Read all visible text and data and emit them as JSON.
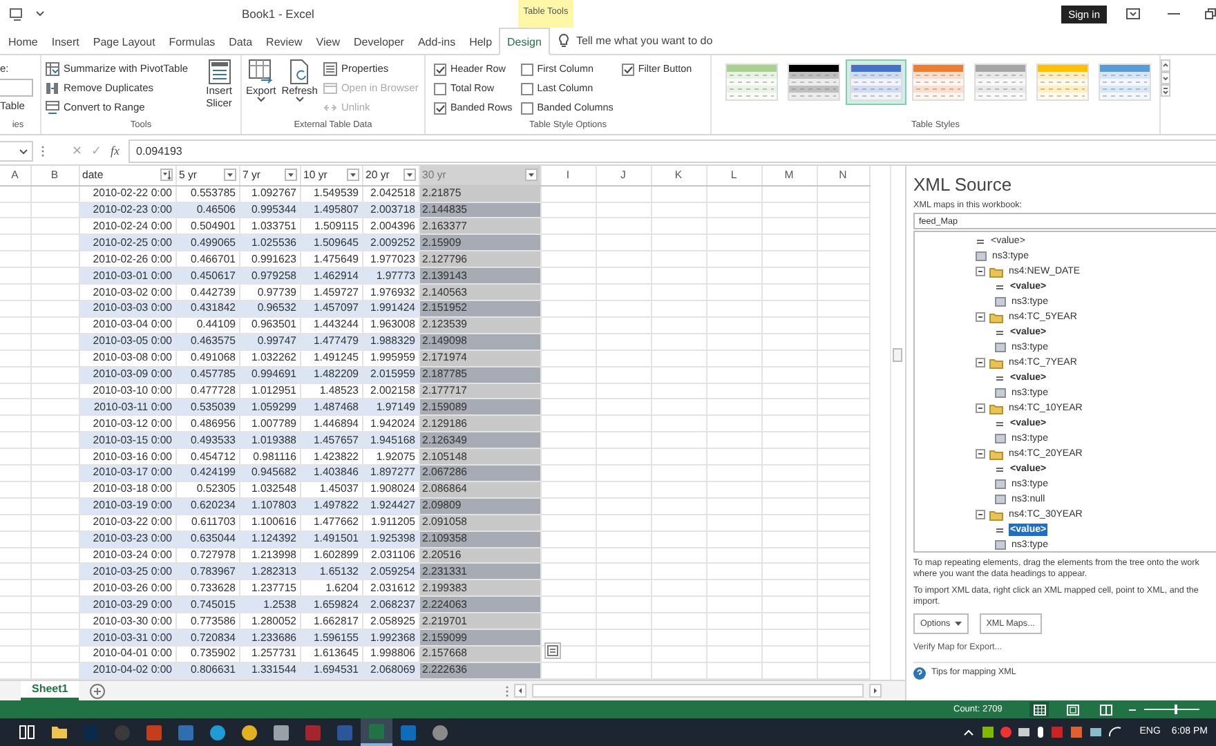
{
  "title_bar": {
    "title": "Book1  -  Excel",
    "context_tab_group": "Table Tools",
    "sign_in": "Sign in"
  },
  "ribbon_tabs": [
    {
      "label": "Home",
      "selected": false
    },
    {
      "label": "Insert",
      "selected": false
    },
    {
      "label": "Page Layout",
      "selected": false
    },
    {
      "label": "Formulas",
      "selected": false
    },
    {
      "label": "Data",
      "selected": false
    },
    {
      "label": "Review",
      "selected": false
    },
    {
      "label": "View",
      "selected": false
    },
    {
      "label": "Developer",
      "selected": false
    },
    {
      "label": "Add-ins",
      "selected": false
    },
    {
      "label": "Help",
      "selected": false
    },
    {
      "label": "Design",
      "selected": true
    }
  ],
  "tell_me": "Tell me what you want to do",
  "ribbon": {
    "properties_group": {
      "name_label": "e:",
      "resize_label": "Table",
      "group_label": "ies"
    },
    "tools_group": {
      "label": "Tools",
      "commands": [
        {
          "label": "Summarize with PivotTable",
          "kind": "pivot"
        },
        {
          "label": "Remove Duplicates",
          "kind": "dedupe"
        },
        {
          "label": "Convert to Range",
          "kind": "range"
        }
      ],
      "insert_slicer": "Insert Slicer"
    },
    "external_group": {
      "label": "External Table Data",
      "export": "Export",
      "refresh": "Refresh",
      "commands": [
        {
          "label": "Properties",
          "kind": "properties",
          "disabled": false
        },
        {
          "label": "Open in Browser",
          "kind": "browser",
          "disabled": true
        },
        {
          "label": "Unlink",
          "kind": "unlink",
          "disabled": true
        }
      ]
    },
    "style_options": {
      "label": "Table Style Options",
      "options": [
        {
          "label": "Header Row",
          "checked": true
        },
        {
          "label": "Total Row",
          "checked": false
        },
        {
          "label": "Banded Rows",
          "checked": true
        },
        {
          "label": "First Column",
          "checked": false
        },
        {
          "label": "Last Column",
          "checked": false
        },
        {
          "label": "Banded Columns",
          "checked": false
        },
        {
          "label": "Filter Button",
          "checked": true
        }
      ]
    },
    "table_styles": {
      "label": "Table Styles",
      "styles": [
        {
          "color": "#a9d08e",
          "selected": false
        },
        {
          "color": "#000000",
          "selected": false
        },
        {
          "color": "#4472c4",
          "selected": true
        },
        {
          "color": "#ed7d31",
          "selected": false
        },
        {
          "color": "#a5a5a5",
          "selected": false
        },
        {
          "color": "#ffc000",
          "selected": false
        },
        {
          "color": "#5b9bd5",
          "selected": false
        }
      ]
    }
  },
  "formula_bar": {
    "cancel": "✕",
    "enter": "✓",
    "function": "fx",
    "value": "0.094193"
  },
  "sheet": {
    "columns": [
      {
        "label": "A",
        "kind": "letter"
      },
      {
        "label": "B",
        "kind": "letter"
      },
      {
        "label": "date",
        "kind": "table",
        "sorted": true,
        "selected": false,
        "stored_as_text": false
      },
      {
        "label": "5 yr",
        "kind": "table",
        "sorted": false,
        "selected": false,
        "stored_as_text": false
      },
      {
        "label": "7 yr",
        "kind": "table",
        "sorted": false,
        "selected": false,
        "stored_as_text": false
      },
      {
        "label": "10 yr",
        "kind": "table",
        "sorted": false,
        "selected": false,
        "stored_as_text": false
      },
      {
        "label": "20 yr",
        "kind": "table",
        "sorted": false,
        "selected": false,
        "stored_as_text": false
      },
      {
        "label": "30 yr",
        "kind": "table",
        "sorted": false,
        "selected": true,
        "stored_as_text": true
      },
      {
        "label": "I",
        "kind": "letter"
      },
      {
        "label": "J",
        "kind": "letter"
      },
      {
        "label": "K",
        "kind": "letter"
      },
      {
        "label": "L",
        "kind": "letter"
      },
      {
        "label": "M",
        "kind": "letter"
      },
      {
        "label": "N",
        "kind": "letter"
      }
    ],
    "rows": [
      [
        "",
        "",
        "2010-02-22 0:00",
        "0.553785",
        "1.092767",
        "1.549539",
        "2.042518",
        "2.21875",
        "",
        "",
        "",
        "",
        "",
        ""
      ],
      [
        "",
        "",
        "2010-02-23 0:00",
        "0.46506",
        "0.995344",
        "1.495807",
        "2.003718",
        "2.144835",
        "",
        "",
        "",
        "",
        "",
        ""
      ],
      [
        "",
        "",
        "2010-02-24 0:00",
        "0.504901",
        "1.033751",
        "1.509115",
        "2.004396",
        "2.163377",
        "",
        "",
        "",
        "",
        "",
        ""
      ],
      [
        "",
        "",
        "2010-02-25 0:00",
        "0.499065",
        "1.025536",
        "1.509645",
        "2.009252",
        "2.15909",
        "",
        "",
        "",
        "",
        "",
        ""
      ],
      [
        "",
        "",
        "2010-02-26 0:00",
        "0.466701",
        "0.991623",
        "1.475649",
        "1.977023",
        "2.127796",
        "",
        "",
        "",
        "",
        "",
        ""
      ],
      [
        "",
        "",
        "2010-03-01 0:00",
        "0.450617",
        "0.979258",
        "1.462914",
        "1.97773",
        "2.139143",
        "",
        "",
        "",
        "",
        "",
        ""
      ],
      [
        "",
        "",
        "2010-03-02 0:00",
        "0.442739",
        "0.97739",
        "1.459727",
        "1.976932",
        "2.140563",
        "",
        "",
        "",
        "",
        "",
        ""
      ],
      [
        "",
        "",
        "2010-03-03 0:00",
        "0.431842",
        "0.96532",
        "1.457097",
        "1.991424",
        "2.151952",
        "",
        "",
        "",
        "",
        "",
        ""
      ],
      [
        "",
        "",
        "2010-03-04 0:00",
        "0.44109",
        "0.963501",
        "1.443244",
        "1.963008",
        "2.123539",
        "",
        "",
        "",
        "",
        "",
        ""
      ],
      [
        "",
        "",
        "2010-03-05 0:00",
        "0.463575",
        "0.99747",
        "1.477479",
        "1.988329",
        "2.149098",
        "",
        "",
        "",
        "",
        "",
        ""
      ],
      [
        "",
        "",
        "2010-03-08 0:00",
        "0.491068",
        "1.032262",
        "1.491245",
        "1.995959",
        "2.171974",
        "",
        "",
        "",
        "",
        "",
        ""
      ],
      [
        "",
        "",
        "2010-03-09 0:00",
        "0.457785",
        "0.994691",
        "1.482209",
        "2.015959",
        "2.187785",
        "",
        "",
        "",
        "",
        "",
        ""
      ],
      [
        "",
        "",
        "2010-03-10 0:00",
        "0.477728",
        "1.012951",
        "1.48523",
        "2.002158",
        "2.177717",
        "",
        "",
        "",
        "",
        "",
        ""
      ],
      [
        "",
        "",
        "2010-03-11 0:00",
        "0.535039",
        "1.059299",
        "1.487468",
        "1.97149",
        "2.159089",
        "",
        "",
        "",
        "",
        "",
        ""
      ],
      [
        "",
        "",
        "2010-03-12 0:00",
        "0.486956",
        "1.007789",
        "1.446894",
        "1.942024",
        "2.129186",
        "",
        "",
        "",
        "",
        "",
        ""
      ],
      [
        "",
        "",
        "2010-03-15 0:00",
        "0.493533",
        "1.019388",
        "1.457657",
        "1.945168",
        "2.126349",
        "",
        "",
        "",
        "",
        "",
        ""
      ],
      [
        "",
        "",
        "2010-03-16 0:00",
        "0.454712",
        "0.981116",
        "1.423822",
        "1.92075",
        "2.105148",
        "",
        "",
        "",
        "",
        "",
        ""
      ],
      [
        "",
        "",
        "2010-03-17 0:00",
        "0.424199",
        "0.945682",
        "1.403846",
        "1.897277",
        "2.067286",
        "",
        "",
        "",
        "",
        "",
        ""
      ],
      [
        "",
        "",
        "2010-03-18 0:00",
        "0.52305",
        "1.032548",
        "1.45037",
        "1.908024",
        "2.086864",
        "",
        "",
        "",
        "",
        "",
        ""
      ],
      [
        "",
        "",
        "2010-03-19 0:00",
        "0.620234",
        "1.107803",
        "1.497822",
        "1.924427",
        "2.09809",
        "",
        "",
        "",
        "",
        "",
        ""
      ],
      [
        "",
        "",
        "2010-03-22 0:00",
        "0.611703",
        "1.100616",
        "1.477662",
        "1.911205",
        "2.091058",
        "",
        "",
        "",
        "",
        "",
        ""
      ],
      [
        "",
        "",
        "2010-03-23 0:00",
        "0.635044",
        "1.124392",
        "1.491501",
        "1.925398",
        "2.109358",
        "",
        "",
        "",
        "",
        "",
        ""
      ],
      [
        "",
        "",
        "2010-03-24 0:00",
        "0.727978",
        "1.213998",
        "1.602899",
        "2.031106",
        "2.20516",
        "",
        "",
        "",
        "",
        "",
        ""
      ],
      [
        "",
        "",
        "2010-03-25 0:00",
        "0.783967",
        "1.282313",
        "1.65132",
        "2.059254",
        "2.231331",
        "",
        "",
        "",
        "",
        "",
        ""
      ],
      [
        "",
        "",
        "2010-03-26 0:00",
        "0.733628",
        "1.237715",
        "1.6204",
        "2.031612",
        "2.199383",
        "",
        "",
        "",
        "",
        "",
        ""
      ],
      [
        "",
        "",
        "2010-03-29 0:00",
        "0.745015",
        "1.2538",
        "1.659824",
        "2.068237",
        "2.224063",
        "",
        "",
        "",
        "",
        "",
        ""
      ],
      [
        "",
        "",
        "2010-03-30 0:00",
        "0.773586",
        "1.280052",
        "1.662817",
        "2.058925",
        "2.219701",
        "",
        "",
        "",
        "",
        "",
        ""
      ],
      [
        "",
        "",
        "2010-03-31 0:00",
        "0.720834",
        "1.233686",
        "1.596155",
        "1.992368",
        "2.159099",
        "",
        "",
        "",
        "",
        "",
        ""
      ],
      [
        "",
        "",
        "2010-04-01 0:00",
        "0.735902",
        "1.257731",
        "1.613645",
        "1.998806",
        "2.157668",
        "",
        "",
        "",
        "",
        "",
        ""
      ],
      [
        "",
        "",
        "2010-04-02 0:00",
        "0.806631",
        "1.331544",
        "1.694531",
        "2.068069",
        "2.222636",
        "",
        "",
        "",
        "",
        "",
        ""
      ]
    ]
  },
  "sheet_tabs": [
    {
      "label": "Sheet1",
      "selected": true
    }
  ],
  "xml_source": {
    "title": "XML Source",
    "maps_label": "XML maps in this workbook:",
    "map": "feed_Map",
    "tree": [
      {
        "label": "<value>",
        "kind": "element",
        "mapped": false,
        "selected": false
      },
      {
        "label": "ns3:type",
        "kind": "attribute",
        "mapped": false,
        "selected": false
      },
      {
        "label": "ns4:NEW_DATE",
        "kind": "folder",
        "expanded": true,
        "selected": false,
        "children": [
          {
            "label": "<value>",
            "kind": "element",
            "mapped": true,
            "selected": false
          },
          {
            "label": "ns3:type",
            "kind": "attribute",
            "mapped": false,
            "selected": false
          }
        ]
      },
      {
        "label": "ns4:TC_5YEAR",
        "kind": "folder",
        "expanded": true,
        "selected": false,
        "children": [
          {
            "label": "<value>",
            "kind": "element",
            "mapped": true,
            "selected": false
          },
          {
            "label": "ns3:type",
            "kind": "attribute",
            "mapped": false,
            "selected": false
          }
        ]
      },
      {
        "label": "ns4:TC_7YEAR",
        "kind": "folder",
        "expanded": true,
        "selected": false,
        "children": [
          {
            "label": "<value>",
            "kind": "element",
            "mapped": true,
            "selected": false
          },
          {
            "label": "ns3:type",
            "kind": "attribute",
            "mapped": false,
            "selected": false
          }
        ]
      },
      {
        "label": "ns4:TC_10YEAR",
        "kind": "folder",
        "expanded": true,
        "selected": false,
        "children": [
          {
            "label": "<value>",
            "kind": "element",
            "mapped": true,
            "selected": false
          },
          {
            "label": "ns3:type",
            "kind": "attribute",
            "mapped": false,
            "selected": false
          }
        ]
      },
      {
        "label": "ns4:TC_20YEAR",
        "kind": "folder",
        "expanded": true,
        "selected": false,
        "children": [
          {
            "label": "<value>",
            "kind": "element",
            "mapped": true,
            "selected": false
          },
          {
            "label": "ns3:type",
            "kind": "attribute",
            "mapped": false,
            "selected": false
          },
          {
            "label": "ns3:null",
            "kind": "attribute",
            "mapped": false,
            "selected": false
          }
        ]
      },
      {
        "label": "ns4:TC_30YEAR",
        "kind": "folder",
        "expanded": true,
        "selected": false,
        "children": [
          {
            "label": "<value>",
            "kind": "element",
            "mapped": true,
            "selected": true
          },
          {
            "label": "ns3:type",
            "kind": "attribute",
            "mapped": false,
            "selected": false
          }
        ]
      }
    ],
    "hints": [
      {
        "lines": [
          "To map repeating elements, drag the elements from the tree onto the work",
          "where you want the data headings to appear."
        ]
      },
      {
        "lines": [
          "To import XML data, right click an XML mapped cell, point to XML, and the",
          "import."
        ]
      }
    ],
    "options_button": "Options",
    "maps_button": "XML Maps...",
    "verify_link": "Verify Map for Export...",
    "tips_link": "Tips for mapping XML"
  },
  "status_bar": {
    "count": "Count: 2709",
    "zoom": {
      "level": 0.55
    }
  },
  "taskbar": {
    "apps": [
      {
        "kind": "task_view",
        "active": false
      },
      {
        "kind": "folder",
        "active": false
      },
      {
        "kind": "tile",
        "color": "#0b2a4a",
        "active": false
      },
      {
        "kind": "circle",
        "color": "#3a3a3a",
        "active": false
      },
      {
        "kind": "tile",
        "color": "#c43e1c",
        "active": false
      },
      {
        "kind": "tile",
        "color": "#2f6fb0",
        "active": false
      },
      {
        "kind": "circle",
        "color": "#1f9bd6",
        "active": false
      },
      {
        "kind": "circle",
        "color": "#e0b020",
        "active": false
      },
      {
        "kind": "tile",
        "color": "#9aa0a8",
        "active": false
      },
      {
        "kind": "tile",
        "color": "#a4262c",
        "active": false
      },
      {
        "kind": "tile",
        "color": "#2b579a",
        "active": false
      },
      {
        "kind": "tile",
        "color": "#217346",
        "active": true
      },
      {
        "kind": "tile",
        "color": "#0f6cbd",
        "active": false
      },
      {
        "kind": "circle",
        "color": "#8a8a8a",
        "active": false
      }
    ],
    "language": "ENG",
    "time": "6:08 PM"
  }
}
